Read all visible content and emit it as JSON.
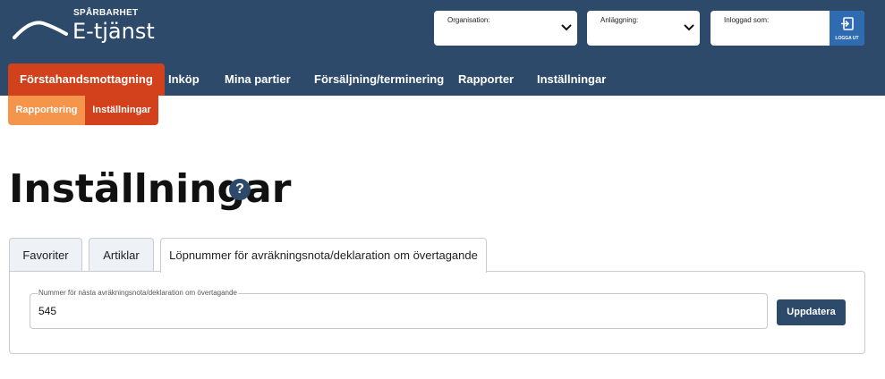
{
  "brand": {
    "small": "SPÅRBARHET",
    "name": "E-tjänst"
  },
  "selectors": {
    "organisation_label": "Organisation:",
    "anlaggning_label": "Anläggning:",
    "inloggad_label": "Inloggad som:",
    "logout_label": "LOGGA UT"
  },
  "nav": [
    {
      "label": "Förstahandsmottagning"
    },
    {
      "label": "Inköp"
    },
    {
      "label": "Mina partier"
    },
    {
      "label": "Försäljning/terminering"
    },
    {
      "label": "Rapporter"
    },
    {
      "label": "Inställningar"
    }
  ],
  "subnav": [
    {
      "label": "Rapportering"
    },
    {
      "label": "Inställningar"
    }
  ],
  "page": {
    "title": "Inställningar",
    "help": "?"
  },
  "tabs": [
    {
      "label": "Favoriter"
    },
    {
      "label": "Artiklar"
    },
    {
      "label": "Löpnummer för avräkningsnota/deklaration om övertagande"
    }
  ],
  "form": {
    "field_label": "Nummer för nästa avräkningsnota/deklaration om övertagande",
    "field_value": "545",
    "update_button": "Uppdatera"
  },
  "colors": {
    "header_bg": "#2d4a6b",
    "nav_active": "#d2401c",
    "subnav_light": "#f5944b",
    "logout_bg": "#2e6bb0"
  }
}
